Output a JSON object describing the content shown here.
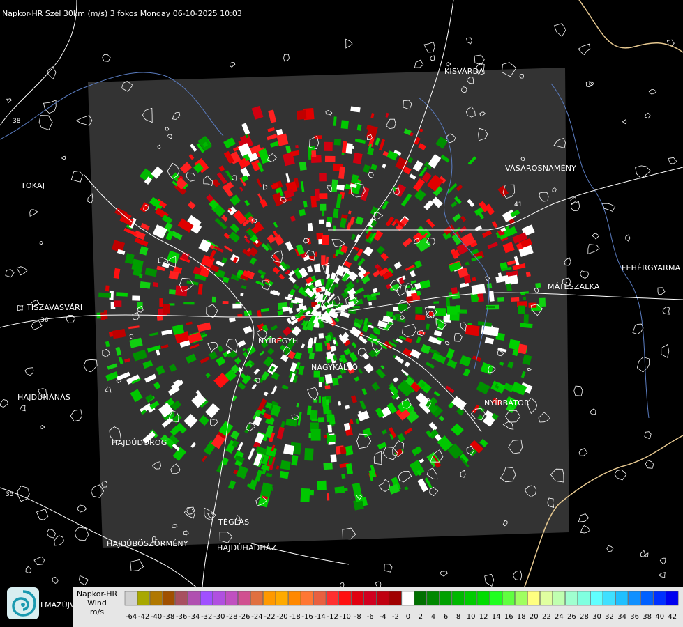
{
  "header": {
    "title": "Napkor-HR Szél 30km (m/s) 3 fokos Monday 06-10-2025 10:03"
  },
  "towns": {
    "kisvarda": "KISVÁRDA",
    "tokaj": "TOKAJ",
    "vasarosnameny": "VÁSÁROSNAMÉNY",
    "fehergyarmat": "FEHÉRGYARMA",
    "mateszalka": "MÁTÉSZALKA",
    "tiszavasvari": "TISZAVASVÁRI",
    "nyiregyhaza": "NYÍREGYH",
    "nagykallo": "NAGYKÁLLÓ",
    "nyirbator": "NYÍRBÁTOR",
    "hajdunanas": "HAJDÚNÁNÁS",
    "hajdudorog": "HAJDÚDOROG",
    "teglas": "TÉGLÁS",
    "hajduboszormeny": "HAJDÚBÖSZÖRMÉNY",
    "hajduhadhaz": "HAJDÚHADHÁZ"
  },
  "road_numbers": {
    "r38": "38",
    "r36": "36",
    "r41": "41",
    "r35": "35"
  },
  "logo_text": "LMAZÚJVÁR",
  "legend": {
    "line1": "Napkor-HR",
    "line2": "Wind",
    "line3": "m/s",
    "ticks": [
      "-64",
      "-42",
      "-40",
      "-38",
      "-36",
      "-34",
      "-32",
      "-30",
      "-28",
      "-26",
      "-24",
      "-22",
      "-20",
      "-18",
      "-16",
      "-14",
      "-12",
      "-10",
      "-8",
      "-6",
      "-4",
      "-2",
      "0",
      "2",
      "4",
      "6",
      "8",
      "10",
      "12",
      "14",
      "16",
      "18",
      "20",
      "22",
      "24",
      "26",
      "28",
      "30",
      "32",
      "34",
      "36",
      "38",
      "40",
      "42"
    ],
    "colors": [
      "#d0d0d0",
      "#a8a800",
      "#b07800",
      "#a05000",
      "#a85060",
      "#b050b0",
      "#a050ff",
      "#b050e0",
      "#c050c0",
      "#d05090",
      "#e07040",
      "#ff9900",
      "#ffaa00",
      "#ff8800",
      "#ff7733",
      "#e86040",
      "#ff3030",
      "#ff1010",
      "#e00010",
      "#d00020",
      "#c00010",
      "#a00000",
      "#ffffff",
      "#007000",
      "#008800",
      "#00a000",
      "#00b800",
      "#00cc00",
      "#00dd00",
      "#20ff20",
      "#60ff40",
      "#a0ff60",
      "#ffff80",
      "#e0ffa0",
      "#c0ffb0",
      "#a0ffd0",
      "#80ffe0",
      "#60ffff",
      "#40e0ff",
      "#20c0ff",
      "#1090ff",
      "#0060ff",
      "#0030ff",
      "#0000f0"
    ]
  },
  "colors": {
    "radar_bg": "#333333",
    "outbound": "#00b000",
    "inbound": "#e00000",
    "near_zero": "#ffffff",
    "border": "#e6c890",
    "river": "#5a7cc0"
  }
}
